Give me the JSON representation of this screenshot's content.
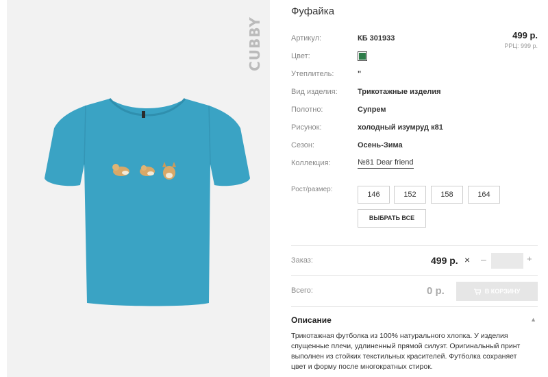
{
  "product": {
    "title": "Фуфайка",
    "brand": "CUBBY",
    "price": "499 р.",
    "rrp": "РРЦ: 999 р."
  },
  "attributes": [
    {
      "label": "Артикул:",
      "value": "КБ 301933"
    },
    {
      "label": "Цвет:",
      "value": "",
      "color": "#2e7d4a"
    },
    {
      "label": "Утеплитель:",
      "value": "\""
    },
    {
      "label": "Вид изделия:",
      "value": "Трикотажные изделия"
    },
    {
      "label": "Полотно:",
      "value": "Супрем"
    },
    {
      "label": "Рисунок:",
      "value": "холодный изумруд к81"
    },
    {
      "label": "Сезон:",
      "value": "Осень-Зима"
    },
    {
      "label": "Коллекция:",
      "value": "№81 Dear friend"
    }
  ],
  "sizes": {
    "label": "Рост/размер:",
    "options": [
      "146",
      "152",
      "158",
      "164"
    ],
    "select_all": "ВЫБРАТЬ ВСЕ"
  },
  "order": {
    "label": "Заказ:",
    "price": "499 р.",
    "times": "×",
    "minus": "–",
    "plus": "+",
    "quantity": ""
  },
  "total": {
    "label": "Всего:",
    "value": "0 р.",
    "cart_button": "В КОРЗИНУ"
  },
  "description": {
    "title": "Описание",
    "caret": "▲",
    "text": "Трикотажная футболка из 100% натурального хлопка. У изделия спущенные плечи, удлиненный прямой силуэт. Оригинальный принт выполнен из стойких текстильных красителей. Футболка сохраняет цвет и форму после многократных стирок."
  },
  "colors": {
    "shirt": "#3aa3c4",
    "swatch": "#2e7d4a"
  }
}
